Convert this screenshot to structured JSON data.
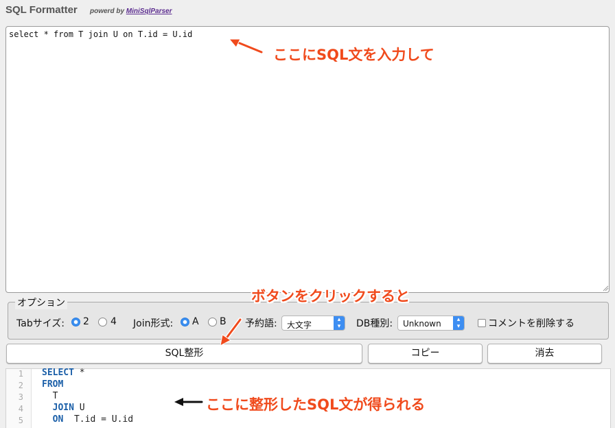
{
  "header": {
    "title": "SQL Formatter",
    "powered_by": "powerd by",
    "powered_link": "MiniSqlParser"
  },
  "input": {
    "value": "select * from T join U on T.id = U.id"
  },
  "options": {
    "legend": "オプション",
    "tab_size_label": "Tabサイズ:",
    "tab_opt1": "2",
    "tab_opt2": "4",
    "tab_selected": "2",
    "join_label": "Join形式:",
    "join_opt1": "A",
    "join_opt2": "B",
    "join_selected": "A",
    "reserved_label": "予約語:",
    "reserved_value": "大文字",
    "db_label": "DB種別:",
    "db_value": "Unknown",
    "remove_comments_label": "コメントを削除する",
    "remove_comments_checked": false
  },
  "buttons": {
    "format": "SQL整形",
    "copy": "コピー",
    "clear": "消去"
  },
  "output": {
    "line_numbers": [
      "1",
      "2",
      "3",
      "4",
      "5"
    ],
    "lines": [
      {
        "kw": "SELECT",
        "rest": " *"
      },
      {
        "kw": "FROM",
        "rest": ""
      },
      {
        "kw": "",
        "rest": "  T"
      },
      {
        "kw": "  JOIN",
        "rest": " U"
      },
      {
        "kw": "  ON",
        "rest": "  T.id = U.id"
      }
    ]
  },
  "annotations": {
    "input_hint": "ここにSQL文を入力して",
    "button_hint": "ボタンをクリックすると",
    "output_hint": "ここに整形したSQL文が得られる"
  },
  "colors": {
    "annotation": "#f04a1c",
    "keyword": "#1b5fa8",
    "radio_accent": "#3b8ff0"
  }
}
